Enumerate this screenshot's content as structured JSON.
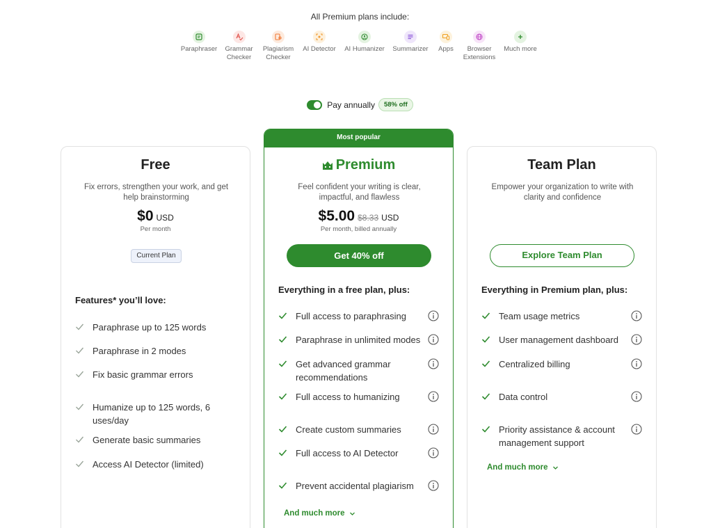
{
  "header": {
    "includes_title": "All Premium plans include:",
    "tools": [
      {
        "label": "Paraphraser",
        "icon": "paraphraser-icon",
        "color": "#2e8b2e",
        "bg": "#e4f3e1"
      },
      {
        "label": "Grammar\nChecker",
        "icon": "grammar-checker-icon",
        "color": "#e0504a",
        "bg": "#fde7e5"
      },
      {
        "label": "Plagiarism\nChecker",
        "icon": "plagiarism-checker-icon",
        "color": "#f07a38",
        "bg": "#fdeadd"
      },
      {
        "label": "AI Detector",
        "icon": "ai-detector-icon",
        "color": "#f09a30",
        "bg": "#fdf0dc"
      },
      {
        "label": "AI Humanizer",
        "icon": "ai-humanizer-icon",
        "color": "#2e8b2e",
        "bg": "#e4f3e1"
      },
      {
        "label": "Summarizer",
        "icon": "summarizer-icon",
        "color": "#8d5ad9",
        "bg": "#efe6fb"
      },
      {
        "label": "Apps",
        "icon": "apps-icon",
        "color": "#f0a020",
        "bg": "#fdf2dc"
      },
      {
        "label": "Browser\nExtensions",
        "icon": "browser-extensions-icon",
        "color": "#c34fc9",
        "bg": "#f7e4f8"
      },
      {
        "label": "Much more",
        "icon": "plus-icon",
        "color": "#2e8b2e",
        "bg": "#e4f3e1"
      }
    ]
  },
  "billing": {
    "label": "Pay annually",
    "discount": "58% off",
    "annual_enabled": true
  },
  "plans": {
    "free": {
      "name": "Free",
      "description": "Fix errors, strengthen your work, and get help brainstorming",
      "price": "$0",
      "currency": "USD",
      "period": "Per month",
      "badge": "Current Plan",
      "features_heading": "Features* you’ll love:",
      "features": [
        "Paraphrase up to 125 words",
        "Paraphrase in 2 modes",
        "Fix basic grammar errors",
        "Humanize up to 125 words, 6 uses/day",
        "Generate basic summaries",
        "Access AI Detector (limited)"
      ]
    },
    "premium": {
      "banner": "Most popular",
      "name": "Premium",
      "description": "Feel confident your writing is clear, impactful, and flawless",
      "price": "$5.00",
      "old_price": "$8.33",
      "currency": "USD",
      "period": "Per month, billed annually",
      "cta": "Get 40% off",
      "features_heading": "Everything in a free plan, plus:",
      "features": [
        "Full access to paraphrasing",
        "Paraphrase in unlimited modes",
        "Get advanced grammar recommendations",
        "Full access to humanizing",
        "Create custom summaries",
        "Full access to AI Detector",
        "Prevent accidental plagiarism"
      ],
      "more": "And much more"
    },
    "team": {
      "name": "Team Plan",
      "description": "Empower your organization to write with clarity and confidence",
      "cta": "Explore Team Plan",
      "features_heading": "Everything in Premium plan, plus:",
      "features": [
        "Team usage metrics",
        "User management dashboard",
        "Centralized billing",
        "Data control",
        "Priority assistance & account management support"
      ],
      "more": "And much more"
    }
  },
  "colors": {
    "brand_green": "#2e8b2e",
    "check_grey": "#9aa59a"
  }
}
